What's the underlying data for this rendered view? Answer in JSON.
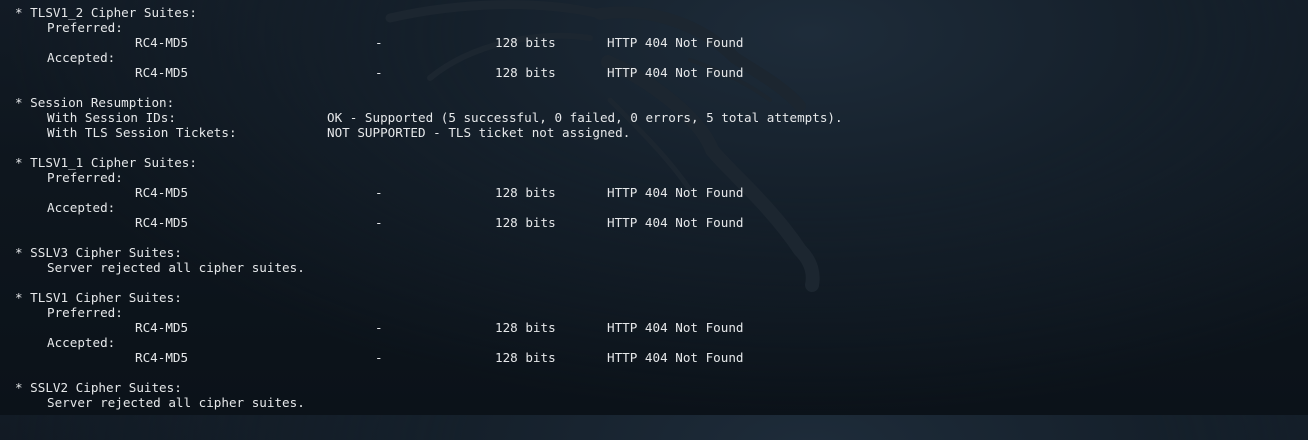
{
  "terminal": {
    "tlsv1_2": {
      "header": "* TLSV1_2 Cipher Suites:",
      "preferred_label": "Preferred:",
      "preferred": {
        "cipher": "RC4-MD5",
        "dash": "-",
        "bits": "128 bits",
        "http": "HTTP 404 Not Found"
      },
      "accepted_label": "Accepted:",
      "accepted": {
        "cipher": "RC4-MD5",
        "dash": "-",
        "bits": "128 bits",
        "http": "HTTP 404 Not Found"
      }
    },
    "session_resumption": {
      "header": "* Session Resumption:",
      "ids_label": "With Session IDs:",
      "ids_value": "OK - Supported (5 successful, 0 failed, 0 errors, 5 total attempts).",
      "tickets_label": "With TLS Session Tickets:",
      "tickets_value": "NOT SUPPORTED - TLS ticket not assigned."
    },
    "tlsv1_1": {
      "header": "* TLSV1_1 Cipher Suites:",
      "preferred_label": "Preferred:",
      "preferred": {
        "cipher": "RC4-MD5",
        "dash": "-",
        "bits": "128 bits",
        "http": "HTTP 404 Not Found"
      },
      "accepted_label": "Accepted:",
      "accepted": {
        "cipher": "RC4-MD5",
        "dash": "-",
        "bits": "128 bits",
        "http": "HTTP 404 Not Found"
      }
    },
    "sslv3": {
      "header": "* SSLV3 Cipher Suites:",
      "message": "Server rejected all cipher suites."
    },
    "tlsv1": {
      "header": "* TLSV1 Cipher Suites:",
      "preferred_label": "Preferred:",
      "preferred": {
        "cipher": "RC4-MD5",
        "dash": "-",
        "bits": "128 bits",
        "http": "HTTP 404 Not Found"
      },
      "accepted_label": "Accepted:",
      "accepted": {
        "cipher": "RC4-MD5",
        "dash": "-",
        "bits": "128 bits",
        "http": "HTTP 404 Not Found"
      }
    },
    "sslv2": {
      "header": "* SSLV2 Cipher Suites:",
      "message": "Server rejected all cipher suites."
    }
  }
}
